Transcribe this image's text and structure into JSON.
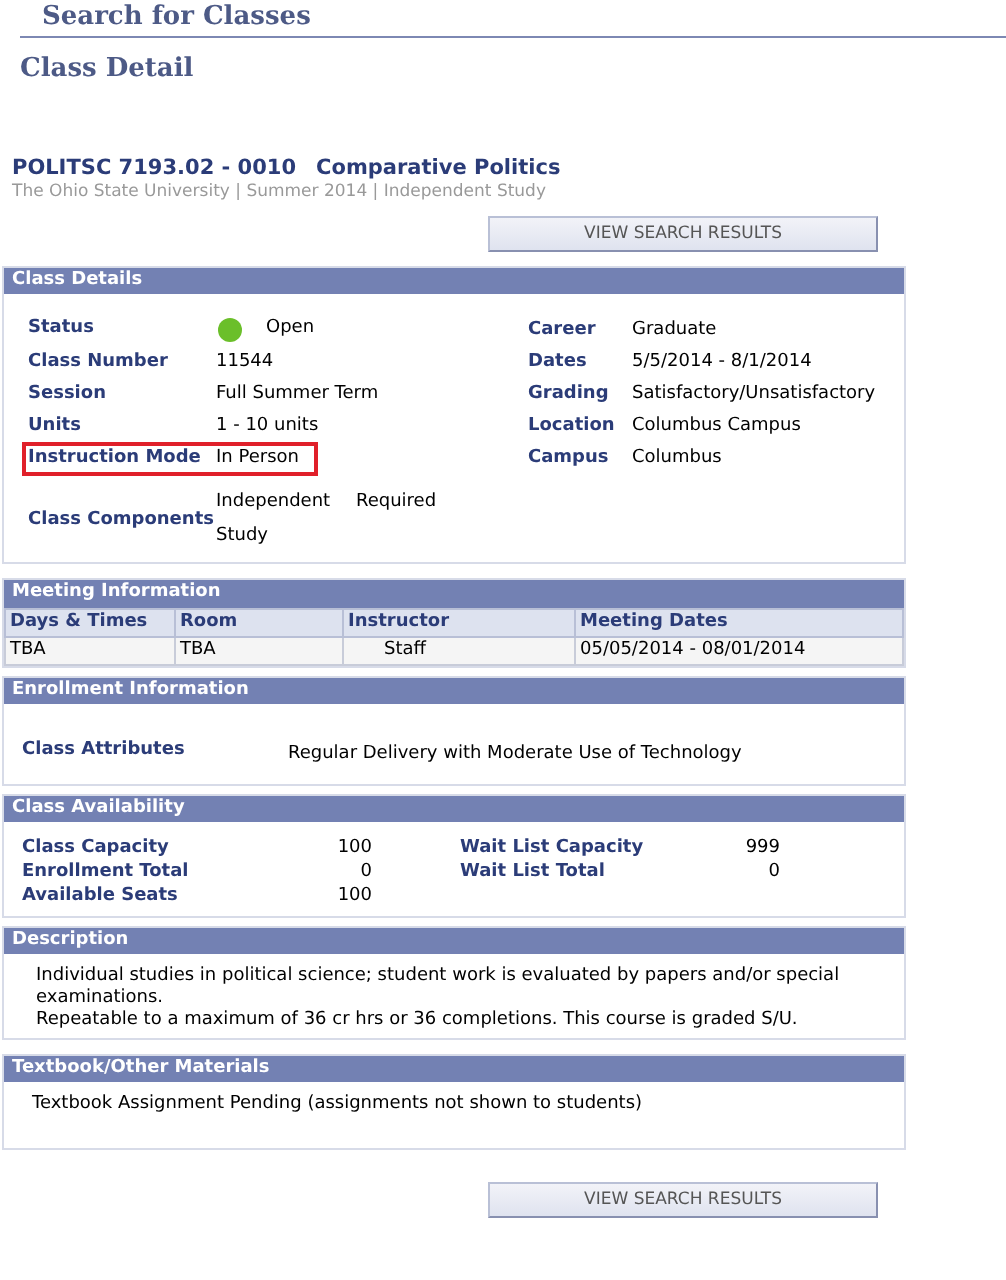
{
  "page_title": "Search for Classes",
  "subtitle": "Class Detail",
  "course": {
    "code": "POLITSC 7193.02 - 0010",
    "name": "Comparative Politics",
    "meta": "The Ohio State University | Summer 2014 | Independent Study"
  },
  "top_button": "VIEW SEARCH RESULTS",
  "class_details": {
    "title": "Class Details",
    "left_fields": [
      {
        "label": "Status",
        "value": "Open",
        "kind": "status",
        "color": "#6bbf2a",
        "highlighted": false
      },
      {
        "label": "Class Number",
        "value": "11544",
        "kind": "text",
        "highlighted": false
      },
      {
        "label": "Session",
        "value": "Full Summer Term",
        "kind": "text",
        "highlighted": false
      },
      {
        "label": "Units",
        "value": "1 - 10 units",
        "kind": "text",
        "highlighted": false
      },
      {
        "label": "Instruction Mode",
        "value": "In Person",
        "kind": "text",
        "highlighted": true
      }
    ],
    "right_fields": [
      {
        "label": "Career",
        "value": "Graduate"
      },
      {
        "label": "Dates",
        "value": "5/5/2014 - 8/1/2014"
      },
      {
        "label": "Grading",
        "value": "Satisfactory/Unsatisfactory"
      },
      {
        "label": "Location",
        "value": "Columbus Campus"
      },
      {
        "label": "Campus",
        "value": "Columbus"
      }
    ],
    "components": {
      "label": "Class Components",
      "values": [
        "Independent Study",
        "Required"
      ]
    }
  },
  "meeting_information": {
    "title": "Meeting Information",
    "columns": [
      "Days & Times",
      "Room",
      "Instructor",
      "Meeting Dates"
    ],
    "rows": [
      [
        "TBA",
        "TBA",
        "Staff",
        "05/05/2014 - 08/01/2014"
      ]
    ]
  },
  "enrollment_information": {
    "title": "Enrollment Information",
    "label": "Class Attributes",
    "value": "Regular Delivery with Moderate Use of Technology"
  },
  "class_availability": {
    "title": "Class Availability",
    "left_fields": [
      {
        "label": "Class Capacity",
        "value": "100"
      },
      {
        "label": "Enrollment Total",
        "value": "0"
      },
      {
        "label": "Available Seats",
        "value": "100"
      }
    ],
    "right_fields": [
      {
        "label": "Wait List Capacity",
        "value": "999"
      },
      {
        "label": "Wait List Total",
        "value": "0"
      }
    ]
  },
  "description": {
    "title": "Description",
    "lines": [
      "Individual studies in political science; student work is evaluated by papers and/or special examinations.",
      "Repeatable to a maximum of 36 cr hrs or 36 completions. This course is graded S/U."
    ]
  },
  "textbook": {
    "title": "Textbook/Other Materials",
    "text": "Textbook Assignment Pending  (assignments not shown to students)"
  },
  "bottom_button": "VIEW SEARCH RESULTS"
}
